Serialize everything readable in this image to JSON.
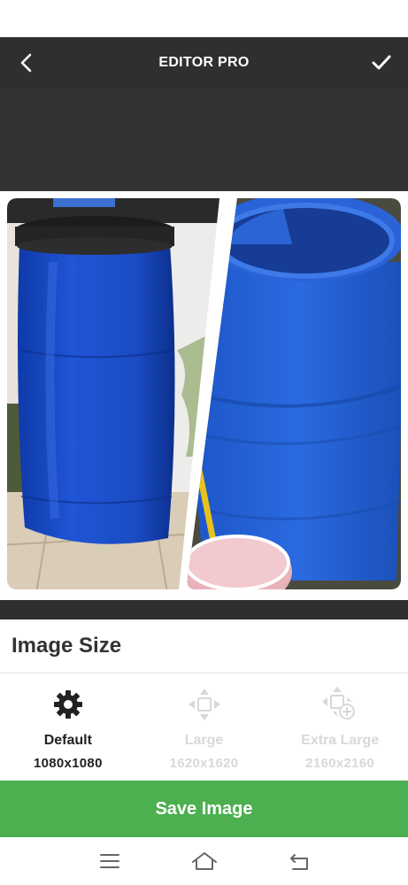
{
  "header": {
    "title": "EDITOR PRO",
    "back_icon": "chevron-left-icon",
    "confirm_icon": "checkmark-icon"
  },
  "collage": {
    "photo_left": "blue-barrel-photo",
    "photo_right": "open-blue-barrel-photo"
  },
  "image_size": {
    "title": "Image Size",
    "options": [
      {
        "label": "Default",
        "dims": "1080x1080",
        "icon": "gear-icon",
        "selected": true
      },
      {
        "label": "Large",
        "dims": "1620x1620",
        "icon": "move-arrows-icon",
        "selected": false
      },
      {
        "label": "Extra Large",
        "dims": "2160x2160",
        "icon": "move-arrows-plus-icon",
        "selected": false
      }
    ]
  },
  "save_button": {
    "label": "Save Image",
    "color": "#4caf50"
  },
  "nav_bar": {
    "recents_icon": "menu-lines-icon",
    "home_icon": "home-icon",
    "back_icon": "back-arrow-icon"
  },
  "colors": {
    "top_bar": "#2f2f2f",
    "dark_area": "#333333",
    "barrel_blue": "#1e4fc8",
    "accent_green": "#4caf50"
  }
}
